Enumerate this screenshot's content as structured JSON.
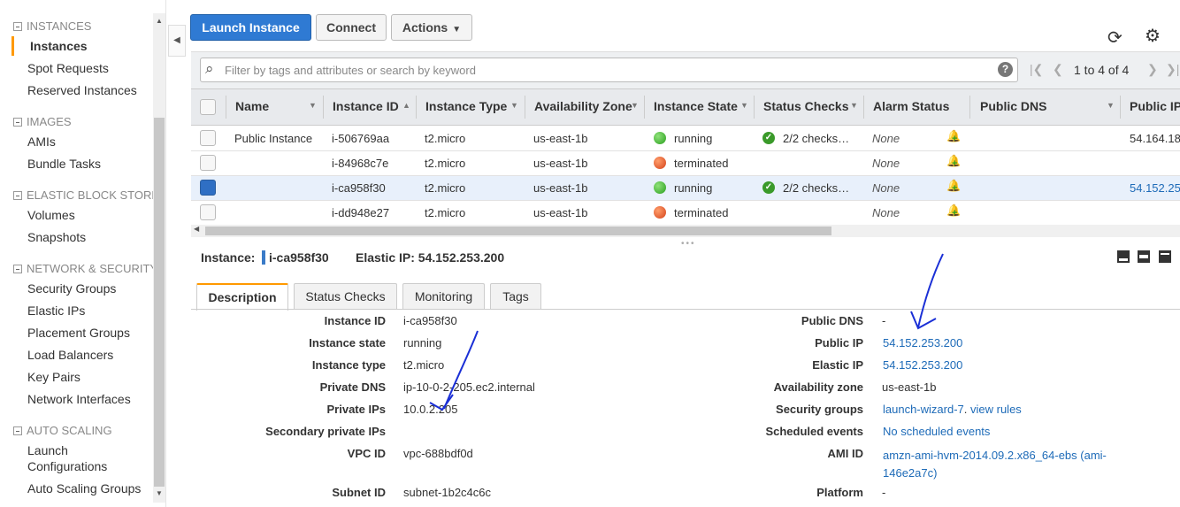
{
  "sidebar": {
    "sections": [
      {
        "title": "INSTANCES",
        "items": [
          "Instances",
          "Spot Requests",
          "Reserved Instances"
        ]
      },
      {
        "title": "IMAGES",
        "items": [
          "AMIs",
          "Bundle Tasks"
        ]
      },
      {
        "title": "ELASTIC BLOCK STORE",
        "items": [
          "Volumes",
          "Snapshots"
        ]
      },
      {
        "title": "NETWORK & SECURITY",
        "items": [
          "Security Groups",
          "Elastic IPs",
          "Placement Groups",
          "Load Balancers",
          "Key Pairs",
          "Network Interfaces"
        ]
      },
      {
        "title": "AUTO SCALING",
        "items": [
          "Launch Configurations",
          "Auto Scaling Groups"
        ]
      }
    ],
    "launch_config_line1": "Launch",
    "launch_config_line2": "Configurations"
  },
  "toolbar": {
    "launch_label": "Launch Instance",
    "connect_label": "Connect",
    "actions_label": "Actions"
  },
  "search": {
    "placeholder": "Filter by tags and attributes or search by keyword",
    "pager_text": "1 to 4 of 4"
  },
  "table": {
    "columns": [
      "Name",
      "Instance ID",
      "Instance Type",
      "Availability Zone",
      "Instance State",
      "Status Checks",
      "Alarm Status",
      "Public DNS",
      "Public IP"
    ],
    "rows": [
      {
        "name": "Public Instance",
        "id": "i-506769aa",
        "type": "t2.micro",
        "zone": "us-east-1b",
        "state": "running",
        "checks": "2/2 checks…",
        "alarm": "None",
        "ip": "54.164.18",
        "selected": false
      },
      {
        "name": "",
        "id": "i-84968c7e",
        "type": "t2.micro",
        "zone": "us-east-1b",
        "state": "terminated",
        "checks": "",
        "alarm": "None",
        "ip": "",
        "selected": false
      },
      {
        "name": "",
        "id": "i-ca958f30",
        "type": "t2.micro",
        "zone": "us-east-1b",
        "state": "running",
        "checks": "2/2 checks…",
        "alarm": "None",
        "ip": "54.152.25",
        "selected": true
      },
      {
        "name": "",
        "id": "i-dd948e27",
        "type": "t2.micro",
        "zone": "us-east-1b",
        "state": "terminated",
        "checks": "",
        "alarm": "None",
        "ip": "",
        "selected": false
      }
    ]
  },
  "details": {
    "instance_label": "Instance:",
    "instance_id": "i-ca958f30",
    "elastic_ip_text": "Elastic IP: 54.152.253.200",
    "tabs": [
      "Description",
      "Status Checks",
      "Monitoring",
      "Tags"
    ],
    "left": [
      {
        "label": "Instance ID",
        "value": "i-ca958f30"
      },
      {
        "label": "Instance state",
        "value": "running"
      },
      {
        "label": "Instance type",
        "value": "t2.micro"
      },
      {
        "label": "Private DNS",
        "value": "ip-10-0-2-205.ec2.internal"
      },
      {
        "label": "Private IPs",
        "value": "10.0.2.205"
      },
      {
        "label": "Secondary private IPs",
        "value": ""
      },
      {
        "label": "VPC ID",
        "value": "vpc-688bdf0d"
      },
      {
        "label": "Subnet ID",
        "value": "subnet-1b2c4c6c"
      }
    ],
    "right": [
      {
        "label": "Public DNS",
        "value": "-"
      },
      {
        "label": "Public IP",
        "value": "54.152.253.200"
      },
      {
        "label": "Elastic IP",
        "value": "54.152.253.200"
      },
      {
        "label": "Availability zone",
        "value": "us-east-1b"
      },
      {
        "label": "Security groups",
        "value": "launch-wizard-7",
        "extra": "view rules"
      },
      {
        "label": "Scheduled events",
        "value": "No scheduled events"
      },
      {
        "label": "AMI ID",
        "value": "amzn-ami-hvm-2014.09.2.x86_64-ebs (ami-",
        "value2": "146e2a7c)"
      },
      {
        "label": "Platform",
        "value": "-"
      }
    ]
  },
  "colors": {
    "accent": "#f90",
    "primary_button": "#2f7ad3",
    "link": "#1e6bb8"
  }
}
